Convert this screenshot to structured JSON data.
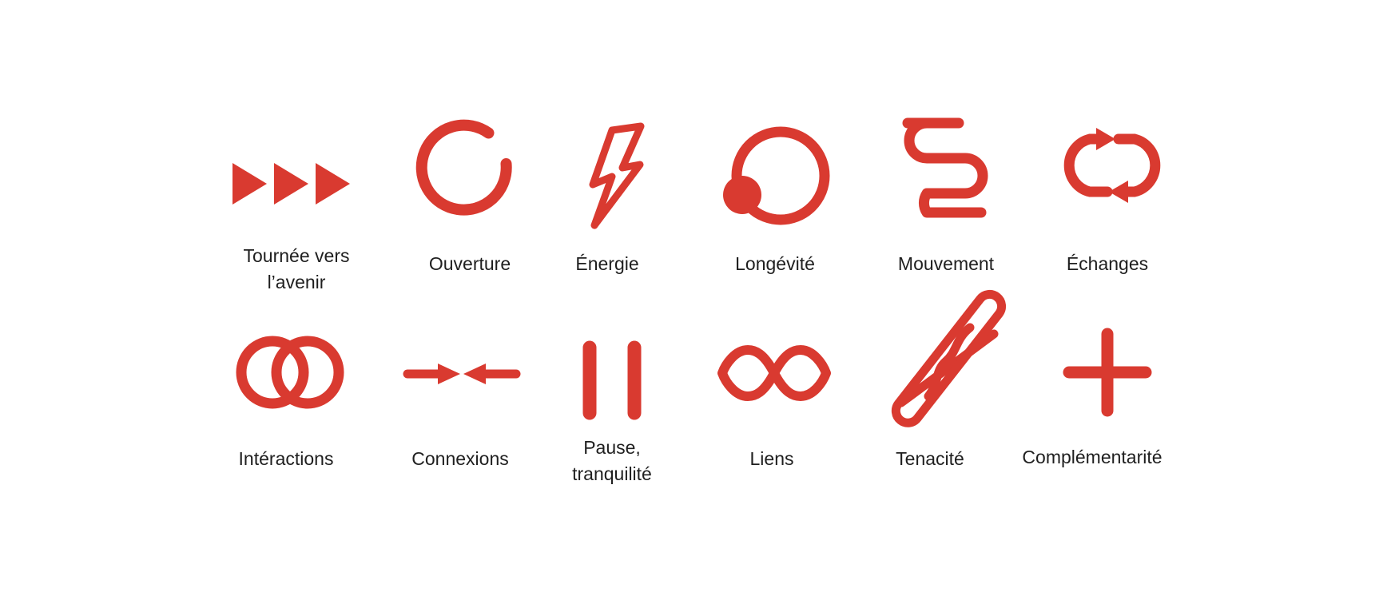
{
  "accent_color": "#d93a30",
  "rows": [
    [
      {
        "icon": "fast-forward-icon",
        "label": "Tournée vers\nl’avenir"
      },
      {
        "icon": "open-circle-icon",
        "label": "Ouverture"
      },
      {
        "icon": "lightning-bolt-icon",
        "label": "Énergie"
      },
      {
        "icon": "circle-with-dot-icon",
        "label": "Longévité"
      },
      {
        "icon": "serpentine-line-icon",
        "label": "Mouvement"
      },
      {
        "icon": "circular-arrows-icon",
        "label": "Échanges"
      }
    ],
    [
      {
        "icon": "interlocking-rings-icon",
        "label": "Intéractions"
      },
      {
        "icon": "converging-arrows-icon",
        "label": "Connexions"
      },
      {
        "icon": "pause-icon",
        "label": "Pause,\ntranquilité"
      },
      {
        "icon": "infinity-icon",
        "label": "Liens"
      },
      {
        "icon": "twisted-knot-icon",
        "label": "Tenacité"
      },
      {
        "icon": "plus-icon",
        "label": "Complémentarité"
      }
    ]
  ]
}
